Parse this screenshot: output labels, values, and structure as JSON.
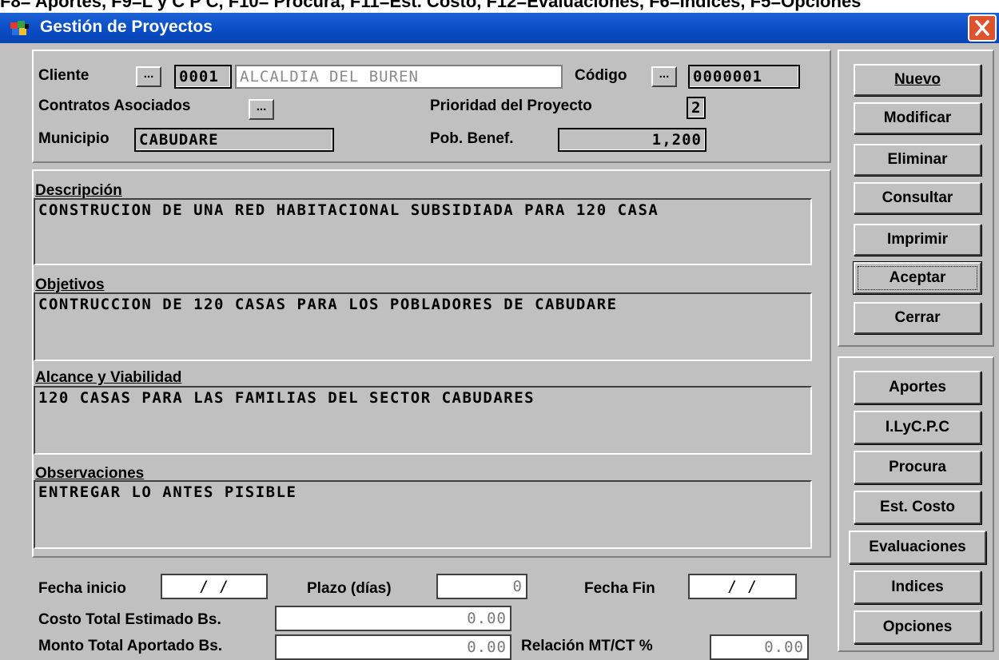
{
  "top_strip_text": "F8= Aportes, F9=L y C P C, F10= Procura, F11=Est. Costo, F12=Evaluaciones, F6=Indices, F5=Opciones",
  "window": {
    "title": "Gestión de Proyectos"
  },
  "header": {
    "cliente_label": "Cliente",
    "cliente_code": "0001",
    "cliente_name": "ALCALDIA DEL BUREN",
    "codigo_label": "Código",
    "codigo_value": "0000001",
    "contratos_label": "Contratos Asociados",
    "prioridad_label": "Prioridad del Proyecto",
    "prioridad_value": "2",
    "municipio_label": "Municipio",
    "municipio_value": "CABUDARE",
    "pob_label": "Pob. Benef.",
    "pob_value": "1,200",
    "lookup_label": "..."
  },
  "texts": {
    "descripcion_label": "Descripción",
    "descripcion_value": "CONSTRUCION DE UNA RED HABITACIONAL SUBSIDIADA PARA 120 CASA",
    "objetivos_label": "Objetivos",
    "objetivos_value": "CONTRUCCION DE 120 CASAS PARA LOS POBLADORES DE CABUDARE",
    "alcance_label": "Alcance y Viabilidad",
    "alcance_value": "120 CASAS PARA LAS FAMILIAS DEL SECTOR CABUDARES",
    "observaciones_label": "Observaciones",
    "observaciones_value": "ENTREGAR LO ANTES PISIBLE"
  },
  "footer": {
    "fecha_inicio_label": "Fecha inicio",
    "fecha_inicio_value": "/ /",
    "plazo_label": "Plazo (días)",
    "plazo_value": "0",
    "fecha_fin_label": "Fecha Fin",
    "fecha_fin_value": "/ /",
    "costo_label": "Costo Total Estimado Bs.",
    "costo_value": "0.00",
    "monto_label": "Monto Total Aportado Bs.",
    "monto_value": "0.00",
    "relacion_label": "Relación MT/CT %",
    "relacion_value": "0.00"
  },
  "actions": {
    "nuevo": "Nuevo",
    "modificar": "Modificar",
    "eliminar": "Eliminar",
    "consultar": "Consultar",
    "imprimir": "Imprimir",
    "aceptar": "Aceptar",
    "cerrar": "Cerrar"
  },
  "modules": {
    "aportes": "Aportes",
    "ilycpc": "I.LyC.P.C",
    "procura": "Procura",
    "est_costo": "Est. Costo",
    "evaluaciones": "Evaluaciones",
    "indices": "Indices",
    "opciones": "Opciones"
  }
}
